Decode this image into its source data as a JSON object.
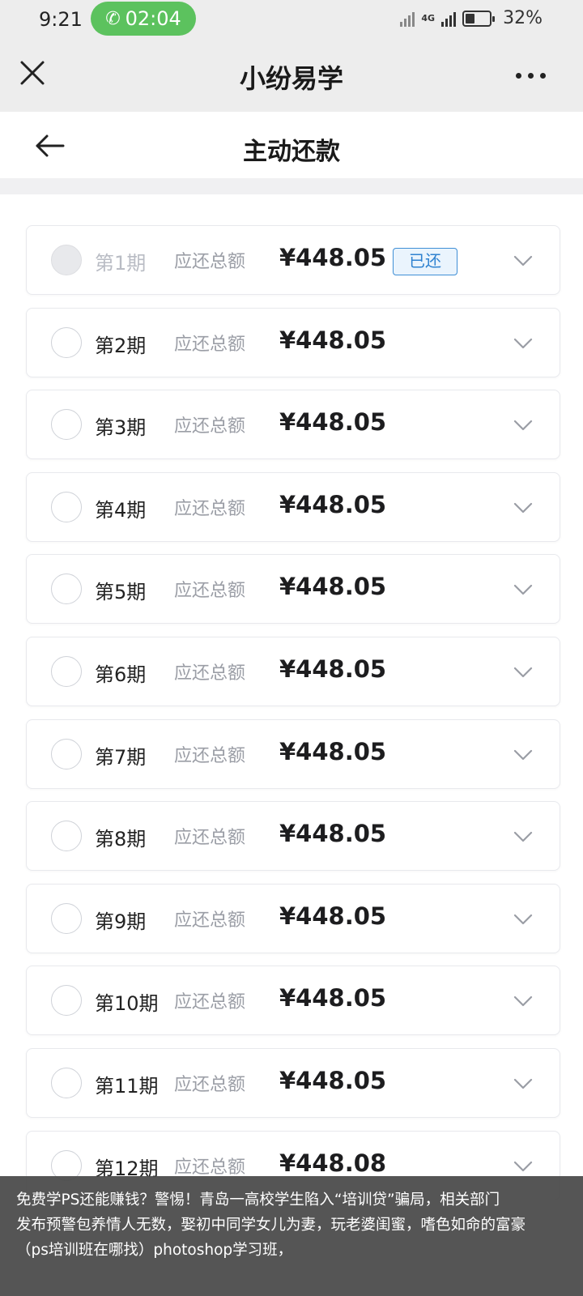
{
  "status_bar": {
    "time": "9:21",
    "call_timer": "02:04",
    "network": "4G",
    "battery": "32%"
  },
  "app_bar": {
    "title": "小纷易学"
  },
  "page": {
    "title": "主动还款"
  },
  "installments": [
    {
      "period": "第1期",
      "label": "应还总额",
      "amount": "¥448.05",
      "status": "已还",
      "paid": true
    },
    {
      "period": "第2期",
      "label": "应还总额",
      "amount": "¥448.05",
      "paid": false
    },
    {
      "period": "第3期",
      "label": "应还总额",
      "amount": "¥448.05",
      "paid": false
    },
    {
      "period": "第4期",
      "label": "应还总额",
      "amount": "¥448.05",
      "paid": false
    },
    {
      "period": "第5期",
      "label": "应还总额",
      "amount": "¥448.05",
      "paid": false
    },
    {
      "period": "第6期",
      "label": "应还总额",
      "amount": "¥448.05",
      "paid": false
    },
    {
      "period": "第7期",
      "label": "应还总额",
      "amount": "¥448.05",
      "paid": false
    },
    {
      "period": "第8期",
      "label": "应还总额",
      "amount": "¥448.05",
      "paid": false
    },
    {
      "period": "第9期",
      "label": "应还总额",
      "amount": "¥448.05",
      "paid": false
    },
    {
      "period": "第10期",
      "label": "应还总额",
      "amount": "¥448.05",
      "paid": false
    },
    {
      "period": "第11期",
      "label": "应还总额",
      "amount": "¥448.05",
      "paid": false
    },
    {
      "period": "第12期",
      "label": "应还总额",
      "amount": "¥448.08",
      "paid": false
    }
  ],
  "caption": {
    "line1": "免费学PS还能赚钱？警惕！青岛一高校学生陷入“培训贷”骗局，相关部门",
    "line2": "发布预警包养情人无数，娶初中同学女儿为妻，玩老婆闺蜜，嗜色如命的富豪",
    "line3": "（ps培训班在哪找）photoshop学习班，"
  },
  "colors": {
    "call_green": "#5cc25e",
    "paid_badge_blue": "#2f82d0",
    "badge_bg": "#eaf4fd"
  }
}
